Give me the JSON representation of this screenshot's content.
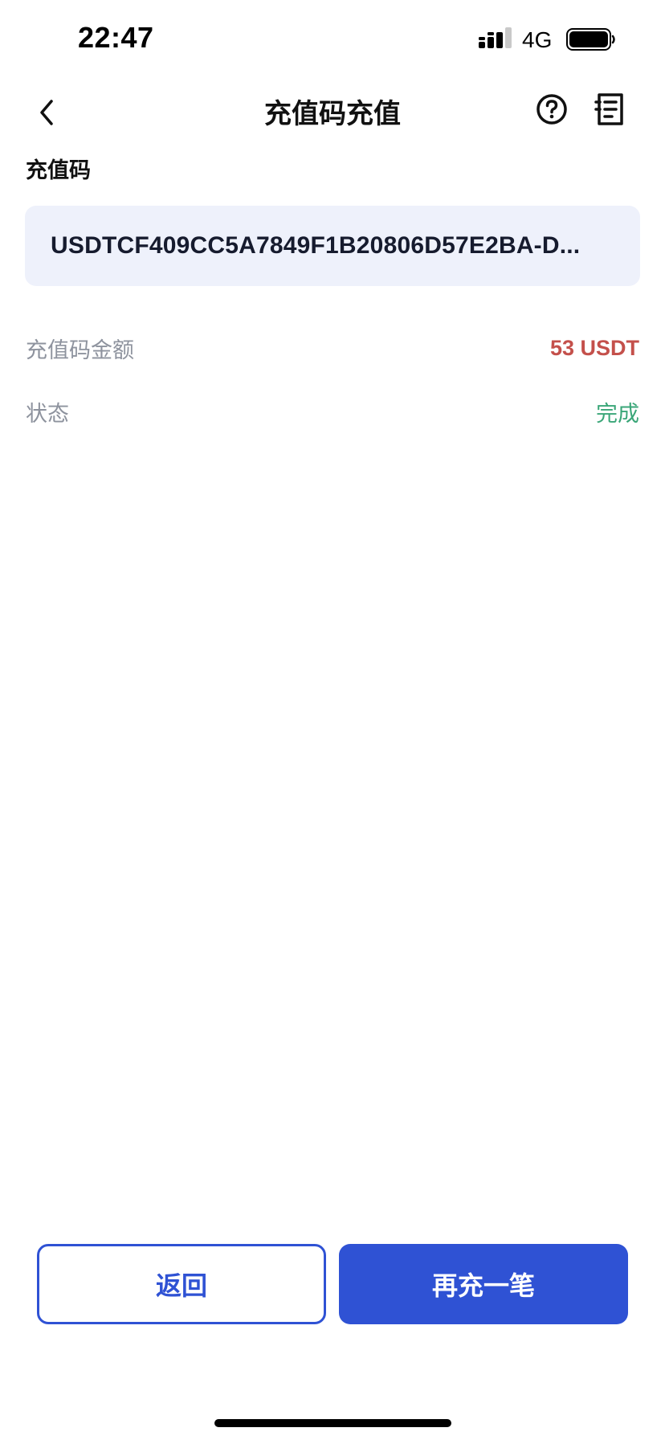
{
  "status_bar": {
    "time": "22:47",
    "network": "4G"
  },
  "nav": {
    "title": "充值码充值",
    "back_icon": "chevron-left-icon",
    "help_icon": "question-circle-icon",
    "record_icon": "record-list-icon"
  },
  "code": {
    "label": "充值码",
    "value": "USDTCF409CC5A7849F1B20806D57E2BA-D..."
  },
  "details": {
    "amount_label": "充值码金额",
    "amount_value": "53 USDT",
    "status_label": "状态",
    "status_value": "完成"
  },
  "actions": {
    "back_label": "返回",
    "again_label": "再充一笔"
  },
  "colors": {
    "primary": "#2f52d4",
    "amount": "#c4504b",
    "status_done": "#3aa678",
    "code_box_bg": "#eef1fb",
    "muted": "#8e939e"
  }
}
